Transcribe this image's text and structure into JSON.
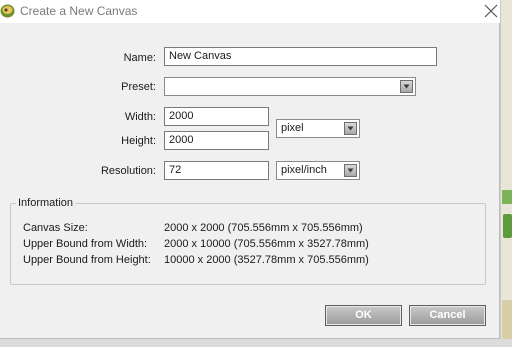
{
  "dialog": {
    "title": "Create a New Canvas",
    "close_icon": "close-icon",
    "app_icon": "app-logo-icon"
  },
  "form": {
    "name_label": "Name:",
    "name_value": "New Canvas",
    "preset_label": "Preset:",
    "preset_value": "",
    "width_label": "Width:",
    "width_value": "2000",
    "height_label": "Height:",
    "height_value": "2000",
    "size_unit": "pixel",
    "resolution_label": "Resolution:",
    "resolution_value": "72",
    "resolution_unit": "pixel/inch"
  },
  "information": {
    "title": "Information",
    "rows": [
      {
        "label": "Canvas Size:",
        "value": "2000 x 2000 (705.556mm x 705.556mm)"
      },
      {
        "label": "Upper Bound from Width:",
        "value": "2000 x 10000 (705.556mm x 3527.78mm)"
      },
      {
        "label": "Upper Bound from Height:",
        "value": "10000 x 2000 (3527.78mm x 705.556mm)"
      }
    ]
  },
  "buttons": {
    "ok": "OK",
    "cancel": "Cancel"
  },
  "colors": {
    "dialog_bg": "#f0f0f0",
    "button_bg": "#b0b0b0",
    "title_text": "#7a7a7a"
  }
}
